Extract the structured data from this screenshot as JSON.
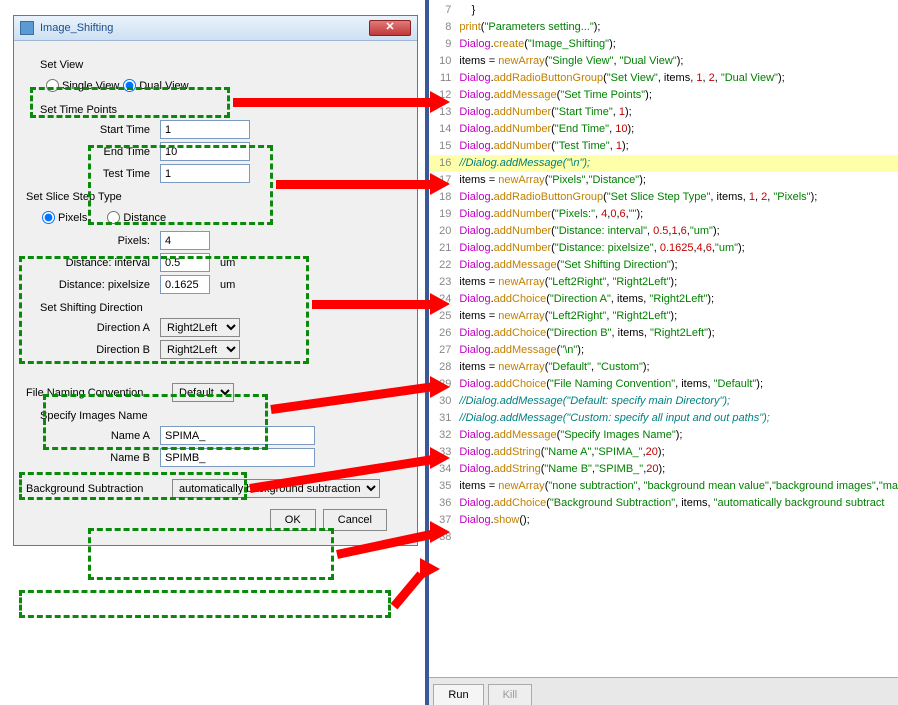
{
  "dialog": {
    "title": "Image_Shifting",
    "sections": {
      "setView": {
        "label": "Set View",
        "opt1": "Single View",
        "opt2": "Dual View"
      },
      "setTimePoints": {
        "label": "Set Time Points",
        "startTime": {
          "label": "Start Time",
          "value": "1"
        },
        "endTime": {
          "label": "End Time",
          "value": "10"
        },
        "testTime": {
          "label": "Test Time",
          "value": "1"
        }
      },
      "sliceStep": {
        "label": "Set Slice Step Type",
        "opt1": "Pixels",
        "opt2": "Distance",
        "pixels": {
          "label": "Pixels:",
          "value": "4"
        },
        "interval": {
          "label": "Distance: interval",
          "value": "0.5",
          "unit": "um"
        },
        "pixelsize": {
          "label": "Distance: pixelsize",
          "value": "0.1625",
          "unit": "um"
        }
      },
      "shiftDir": {
        "label": "Set Shifting Direction",
        "dirA": {
          "label": "Direction A",
          "value": "Right2Left"
        },
        "dirB": {
          "label": "Direction B",
          "value": "Right2Left"
        }
      },
      "fileNaming": {
        "label": "File Naming Convention",
        "value": "Default"
      },
      "imagesName": {
        "label": "Specify Images Name",
        "nameA": {
          "label": "Name A",
          "value": "SPIMA_"
        },
        "nameB": {
          "label": "Name B",
          "value": "SPIMB_"
        }
      },
      "bgSub": {
        "label": "Background Subtraction",
        "value": "automatically background subtraction"
      }
    },
    "buttons": {
      "ok": "OK",
      "cancel": "Cancel"
    }
  },
  "code": {
    "lines": [
      {
        "n": 7,
        "t": [
          [
            "punct",
            "    }"
          ]
        ]
      },
      {
        "n": 8,
        "t": [
          [
            "method",
            "print"
          ],
          [
            "punct",
            "("
          ],
          [
            "str",
            "\"Parameters setting...\""
          ],
          [
            "punct",
            ");"
          ]
        ]
      },
      {
        "n": 9,
        "t": [
          [
            "obj",
            "Dialog"
          ],
          [
            "punct",
            "."
          ],
          [
            "method",
            "create"
          ],
          [
            "punct",
            "("
          ],
          [
            "str",
            "\"Image_Shifting\""
          ],
          [
            "punct",
            ");"
          ]
        ]
      },
      {
        "n": 10,
        "t": [
          [
            "punct",
            "items = "
          ],
          [
            "method",
            "newArray"
          ],
          [
            "punct",
            "("
          ],
          [
            "str",
            "\"Single View\""
          ],
          [
            "punct",
            ", "
          ],
          [
            "str",
            "\"Dual View\""
          ],
          [
            "punct",
            ");"
          ]
        ]
      },
      {
        "n": 11,
        "t": [
          [
            "obj",
            "Dialog"
          ],
          [
            "punct",
            "."
          ],
          [
            "method",
            "addRadioButtonGroup"
          ],
          [
            "punct",
            "("
          ],
          [
            "str",
            "\"Set View\""
          ],
          [
            "punct",
            ", items, "
          ],
          [
            "num",
            "1"
          ],
          [
            "punct",
            ", "
          ],
          [
            "num",
            "2"
          ],
          [
            "punct",
            ", "
          ],
          [
            "str",
            "\"Dual View\""
          ],
          [
            "punct",
            ");"
          ]
        ]
      },
      {
        "n": 12,
        "t": [
          [
            "obj",
            "Dialog"
          ],
          [
            "punct",
            "."
          ],
          [
            "method",
            "addMessage"
          ],
          [
            "punct",
            "("
          ],
          [
            "str",
            "\"Set Time Points\""
          ],
          [
            "punct",
            ");"
          ]
        ]
      },
      {
        "n": 13,
        "t": [
          [
            "obj",
            "Dialog"
          ],
          [
            "punct",
            "."
          ],
          [
            "method",
            "addNumber"
          ],
          [
            "punct",
            "("
          ],
          [
            "str",
            "\"Start Time\""
          ],
          [
            "punct",
            ", "
          ],
          [
            "num",
            "1"
          ],
          [
            "punct",
            ");"
          ]
        ]
      },
      {
        "n": 14,
        "t": [
          [
            "obj",
            "Dialog"
          ],
          [
            "punct",
            "."
          ],
          [
            "method",
            "addNumber"
          ],
          [
            "punct",
            "("
          ],
          [
            "str",
            "\"End Time\""
          ],
          [
            "punct",
            ", "
          ],
          [
            "num",
            "10"
          ],
          [
            "punct",
            ");"
          ]
        ]
      },
      {
        "n": 15,
        "t": [
          [
            "obj",
            "Dialog"
          ],
          [
            "punct",
            "."
          ],
          [
            "method",
            "addNumber"
          ],
          [
            "punct",
            "("
          ],
          [
            "str",
            "\"Test Time\""
          ],
          [
            "punct",
            ", "
          ],
          [
            "num",
            "1"
          ],
          [
            "punct",
            ");"
          ]
        ]
      },
      {
        "n": 16,
        "hl": true,
        "t": [
          [
            "comment",
            "//Dialog.addMessage(\"\\n\");"
          ]
        ]
      },
      {
        "n": 17,
        "t": [
          [
            "punct",
            "items = "
          ],
          [
            "method",
            "newArray"
          ],
          [
            "punct",
            "("
          ],
          [
            "str",
            "\"Pixels\""
          ],
          [
            "punct",
            ","
          ],
          [
            "str",
            "\"Distance\""
          ],
          [
            "punct",
            ");"
          ]
        ]
      },
      {
        "n": 18,
        "t": [
          [
            "obj",
            "Dialog"
          ],
          [
            "punct",
            "."
          ],
          [
            "method",
            "addRadioButtonGroup"
          ],
          [
            "punct",
            "("
          ],
          [
            "str",
            "\"Set Slice Step Type\""
          ],
          [
            "punct",
            ", items, "
          ],
          [
            "num",
            "1"
          ],
          [
            "punct",
            ", "
          ],
          [
            "num",
            "2"
          ],
          [
            "punct",
            ", "
          ],
          [
            "str",
            "\"Pixels\""
          ],
          [
            "punct",
            ");"
          ]
        ]
      },
      {
        "n": 19,
        "t": [
          [
            "obj",
            "Dialog"
          ],
          [
            "punct",
            "."
          ],
          [
            "method",
            "addNumber"
          ],
          [
            "punct",
            "("
          ],
          [
            "str",
            "\"Pixels:\""
          ],
          [
            "punct",
            ", "
          ],
          [
            "num",
            "4"
          ],
          [
            "punct",
            ","
          ],
          [
            "num",
            "0"
          ],
          [
            "punct",
            ","
          ],
          [
            "num",
            "6"
          ],
          [
            "punct",
            ","
          ],
          [
            "str",
            "\"\""
          ],
          [
            "punct",
            ");"
          ]
        ]
      },
      {
        "n": 20,
        "t": [
          [
            "obj",
            "Dialog"
          ],
          [
            "punct",
            "."
          ],
          [
            "method",
            "addNumber"
          ],
          [
            "punct",
            "("
          ],
          [
            "str",
            "\"Distance: interval\""
          ],
          [
            "punct",
            ", "
          ],
          [
            "num",
            "0.5"
          ],
          [
            "punct",
            ","
          ],
          [
            "num",
            "1"
          ],
          [
            "punct",
            ","
          ],
          [
            "num",
            "6"
          ],
          [
            "punct",
            ","
          ],
          [
            "str",
            "\"um\""
          ],
          [
            "punct",
            ");"
          ]
        ]
      },
      {
        "n": 21,
        "t": [
          [
            "obj",
            "Dialog"
          ],
          [
            "punct",
            "."
          ],
          [
            "method",
            "addNumber"
          ],
          [
            "punct",
            "("
          ],
          [
            "str",
            "\"Distance: pixelsize\""
          ],
          [
            "punct",
            ", "
          ],
          [
            "num",
            "0.1625"
          ],
          [
            "punct",
            ","
          ],
          [
            "num",
            "4"
          ],
          [
            "punct",
            ","
          ],
          [
            "num",
            "6"
          ],
          [
            "punct",
            ","
          ],
          [
            "str",
            "\"um\""
          ],
          [
            "punct",
            ");"
          ]
        ]
      },
      {
        "n": 22,
        "t": [
          [
            "obj",
            "Dialog"
          ],
          [
            "punct",
            "."
          ],
          [
            "method",
            "addMessage"
          ],
          [
            "punct",
            "("
          ],
          [
            "str",
            "\"Set Shifting Direction\""
          ],
          [
            "punct",
            ");"
          ]
        ]
      },
      {
        "n": 23,
        "t": [
          [
            "punct",
            "items = "
          ],
          [
            "method",
            "newArray"
          ],
          [
            "punct",
            "("
          ],
          [
            "str",
            "\"Left2Right\""
          ],
          [
            "punct",
            ", "
          ],
          [
            "str",
            "\"Right2Left\""
          ],
          [
            "punct",
            ");"
          ]
        ]
      },
      {
        "n": 24,
        "t": [
          [
            "obj",
            "Dialog"
          ],
          [
            "punct",
            "."
          ],
          [
            "method",
            "addChoice"
          ],
          [
            "punct",
            "("
          ],
          [
            "str",
            "\"Direction A\""
          ],
          [
            "punct",
            ", items, "
          ],
          [
            "str",
            "\"Right2Left\""
          ],
          [
            "punct",
            ");"
          ]
        ]
      },
      {
        "n": 25,
        "t": [
          [
            "punct",
            "items = "
          ],
          [
            "method",
            "newArray"
          ],
          [
            "punct",
            "("
          ],
          [
            "str",
            "\"Left2Right\""
          ],
          [
            "punct",
            ", "
          ],
          [
            "str",
            "\"Right2Left\""
          ],
          [
            "punct",
            ");"
          ]
        ]
      },
      {
        "n": 26,
        "t": [
          [
            "obj",
            "Dialog"
          ],
          [
            "punct",
            "."
          ],
          [
            "method",
            "addChoice"
          ],
          [
            "punct",
            "("
          ],
          [
            "str",
            "\"Direction B\""
          ],
          [
            "punct",
            ", items, "
          ],
          [
            "str",
            "\"Right2Left\""
          ],
          [
            "punct",
            ");"
          ]
        ]
      },
      {
        "n": 27,
        "t": [
          [
            "obj",
            "Dialog"
          ],
          [
            "punct",
            "."
          ],
          [
            "method",
            "addMessage"
          ],
          [
            "punct",
            "("
          ],
          [
            "str",
            "\"\\n\""
          ],
          [
            "punct",
            ");"
          ]
        ]
      },
      {
        "n": 28,
        "t": [
          [
            "punct",
            "items = "
          ],
          [
            "method",
            "newArray"
          ],
          [
            "punct",
            "("
          ],
          [
            "str",
            "\"Default\""
          ],
          [
            "punct",
            ", "
          ],
          [
            "str",
            "\"Custom\""
          ],
          [
            "punct",
            ");"
          ]
        ]
      },
      {
        "n": 29,
        "t": [
          [
            "obj",
            "Dialog"
          ],
          [
            "punct",
            "."
          ],
          [
            "method",
            "addChoice"
          ],
          [
            "punct",
            "("
          ],
          [
            "str",
            "\"File Naming Convention\""
          ],
          [
            "punct",
            ", items, "
          ],
          [
            "str",
            "\"Default\""
          ],
          [
            "punct",
            ");"
          ]
        ]
      },
      {
        "n": 30,
        "t": [
          [
            "comment",
            "//Dialog.addMessage(\"Default: specify main Directory\");"
          ]
        ]
      },
      {
        "n": 31,
        "t": [
          [
            "comment",
            "//Dialog.addMessage(\"Custom: specify all input and out paths\");"
          ]
        ]
      },
      {
        "n": 32,
        "t": [
          [
            "obj",
            "Dialog"
          ],
          [
            "punct",
            "."
          ],
          [
            "method",
            "addMessage"
          ],
          [
            "punct",
            "("
          ],
          [
            "str",
            "\"Specify Images Name\""
          ],
          [
            "punct",
            ");"
          ]
        ]
      },
      {
        "n": 33,
        "t": [
          [
            "obj",
            "Dialog"
          ],
          [
            "punct",
            "."
          ],
          [
            "method",
            "addString"
          ],
          [
            "punct",
            "("
          ],
          [
            "str",
            "\"Name A\""
          ],
          [
            "punct",
            ","
          ],
          [
            "str",
            "\"SPIMA_\""
          ],
          [
            "punct",
            ","
          ],
          [
            "num",
            "20"
          ],
          [
            "punct",
            ");"
          ]
        ]
      },
      {
        "n": 34,
        "t": [
          [
            "obj",
            "Dialog"
          ],
          [
            "punct",
            "."
          ],
          [
            "method",
            "addString"
          ],
          [
            "punct",
            "("
          ],
          [
            "str",
            "\"Name B\""
          ],
          [
            "punct",
            ","
          ],
          [
            "str",
            "\"SPIMB_\""
          ],
          [
            "punct",
            ","
          ],
          [
            "num",
            "20"
          ],
          [
            "punct",
            ");"
          ]
        ]
      },
      {
        "n": 35,
        "t": [
          [
            "punct",
            "items = "
          ],
          [
            "method",
            "newArray"
          ],
          [
            "punct",
            "("
          ],
          [
            "str",
            "\"none subtraction\""
          ],
          [
            "punct",
            ", "
          ],
          [
            "str",
            "\"background mean value\""
          ],
          [
            "punct",
            ","
          ],
          [
            "str",
            "\"background images\""
          ],
          [
            "punct",
            ","
          ],
          [
            "str",
            "\"ma"
          ]
        ]
      },
      {
        "n": 36,
        "t": [
          [
            "obj",
            "Dialog"
          ],
          [
            "punct",
            "."
          ],
          [
            "method",
            "addChoice"
          ],
          [
            "punct",
            "("
          ],
          [
            "str",
            "\"Background Subtraction\""
          ],
          [
            "punct",
            ", items, "
          ],
          [
            "str",
            "\"automatically background subtract"
          ]
        ]
      },
      {
        "n": 37,
        "t": [
          [
            "obj",
            "Dialog"
          ],
          [
            "punct",
            "."
          ],
          [
            "method",
            "show"
          ],
          [
            "punct",
            "();"
          ]
        ]
      },
      {
        "n": 38,
        "t": [
          [
            "punct",
            " "
          ]
        ]
      }
    ]
  },
  "tabs": {
    "run": "Run",
    "kill": "Kill"
  }
}
